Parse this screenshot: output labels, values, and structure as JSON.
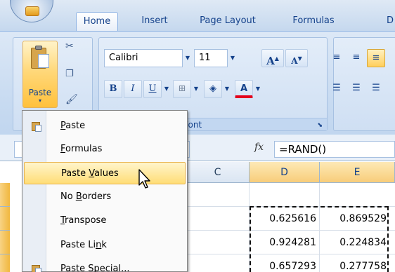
{
  "tabs": [
    {
      "label": "Home",
      "active": true
    },
    {
      "label": "Insert",
      "active": false
    },
    {
      "label": "Page Layout",
      "active": false
    },
    {
      "label": "Formulas",
      "active": false
    },
    {
      "label": "D",
      "active": false
    }
  ],
  "clipboard": {
    "paste_label": "Paste",
    "paste_arrow": "▾"
  },
  "font": {
    "name": "Calibri",
    "size": "11",
    "bold": "B",
    "italic": "I",
    "underline": "U",
    "grow": "A",
    "shrink": "A",
    "color_letter": "A",
    "group_label_partial": "Font"
  },
  "formula_bar": {
    "fx": "fx",
    "formula": "=RAND()"
  },
  "columns": [
    {
      "label": "C",
      "selected": false
    },
    {
      "label": "D",
      "selected": true
    },
    {
      "label": "E",
      "selected": true
    }
  ],
  "cells": [
    [
      "0.625616",
      "0.869529"
    ],
    [
      "0.924281",
      "0.224834"
    ],
    [
      "0.657293",
      "0.277758"
    ]
  ],
  "paste_menu": {
    "items": [
      {
        "pre": "",
        "acc": "P",
        "post": "aste",
        "icon": "paste-icon",
        "highlighted": false
      },
      {
        "pre": "",
        "acc": "F",
        "post": "ormulas",
        "icon": "",
        "highlighted": false
      },
      {
        "pre": "Paste ",
        "acc": "V",
        "post": "alues",
        "icon": "",
        "highlighted": true
      },
      {
        "pre": "No ",
        "acc": "B",
        "post": "orders",
        "icon": "",
        "highlighted": false
      },
      {
        "pre": "",
        "acc": "T",
        "post": "ranspose",
        "icon": "",
        "highlighted": false
      },
      {
        "pre": "Paste Li",
        "acc": "n",
        "post": "k",
        "icon": "",
        "highlighted": false
      },
      {
        "pre": "Paste ",
        "acc": "S",
        "post": "pecial...",
        "icon": "paste-special-icon",
        "highlighted": false
      }
    ]
  },
  "colors": {
    "accent": "#15428b",
    "hover": "#ffdd76",
    "font_color_bar": "#e4001b"
  }
}
